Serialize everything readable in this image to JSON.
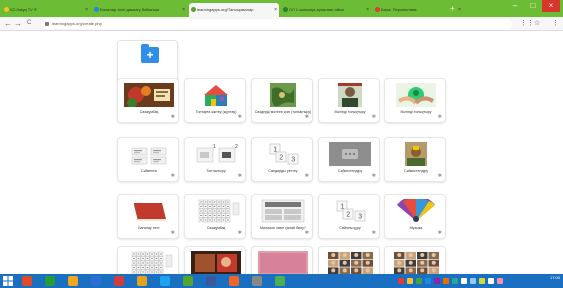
{
  "browser": {
    "tabs": [
      {
        "title": "KZ-Halyq TV ®",
        "color": "#f0c419",
        "active": false
      },
      {
        "title": "Балалар тілін дамыту бойынша",
        "color": "#1e88e5",
        "active": false
      },
      {
        "title": "learningapps.org/Тапсырмалар",
        "color": "#5aa02c",
        "active": true
      },
      {
        "title": "ОЛ 1 сыныпқа арналған ойын",
        "color": "#2e7d32",
        "active": false
      },
      {
        "title": "Бала. Перспектива",
        "color": "#e53935",
        "active": false
      }
    ],
    "tab_close_glyph": "×",
    "new_tab_glyph": "+",
    "window_controls": [
      "–",
      "□",
      "×"
    ],
    "url": "learningapps.org/create.php",
    "nav_glyphs": {
      "back": "←",
      "forward": "→",
      "reload": "C"
    },
    "right_glyphs": [
      "⋮⋮",
      "☆",
      "⋮"
    ]
  },
  "add_tile": {
    "icon": "add-folder-icon",
    "glyph": "+"
  },
  "gear_glyph": "✱",
  "tiles": [
    {
      "label": "Сөзжұмбақ",
      "thumb": "crossword-photo",
      "row": 0,
      "col": 0
    },
    {
      "label": "Топтарға жіктеу (жұптау)",
      "thumb": "colorful-house",
      "row": 0,
      "col": 1
    },
    {
      "label": "Сөздерді мәтінге қою (толықтыру)",
      "thumb": "green-map",
      "row": 0,
      "col": 2
    },
    {
      "label": "Мәтінді толықтыру",
      "thumb": "portrait",
      "row": 0,
      "col": 3
    },
    {
      "label": "Мәтінді толықтыру",
      "thumb": "green-hands",
      "row": 0,
      "col": 4
    },
    {
      "label": "Сәйкестік",
      "thumb": "matching-cards",
      "row": 1,
      "col": 0
    },
    {
      "label": "Топтастыру",
      "thumb": "grouping-cards",
      "row": 1,
      "col": 1
    },
    {
      "label": "Сандарды реттеу",
      "thumb": "numbers-123",
      "row": 1,
      "col": 2
    },
    {
      "label": "Сәйкестендіру",
      "thumb": "grey-chat",
      "row": 1,
      "col": 3
    },
    {
      "label": "Сәйкестендіру",
      "thumb": "photo-quiz",
      "row": 1,
      "col": 4
    },
    {
      "label": "Бағалау тест",
      "thumb": "red-book",
      "row": 2,
      "col": 0
    },
    {
      "label": "Сөзжұмбақ",
      "thumb": "letter-grid",
      "row": 2,
      "col": 1
    },
    {
      "label": "Миллион кімге қалай бөлу?",
      "thumb": "quiz-form",
      "row": 2,
      "col": 2
    },
    {
      "label": "Сөйлем құру",
      "thumb": "numbers-123",
      "row": 2,
      "col": 3
    },
    {
      "label": "Музыка",
      "thumb": "music-fan",
      "row": 2,
      "col": 4
    },
    {
      "label": "",
      "thumb": "letter-grid",
      "row": 3,
      "col": 0
    },
    {
      "label": "",
      "thumb": "video",
      "row": 3,
      "col": 1
    },
    {
      "label": "",
      "thumb": "pink-paper",
      "row": 3,
      "col": 2
    },
    {
      "label": "",
      "thumb": "face-grid",
      "row": 3,
      "col": 3
    },
    {
      "label": "",
      "thumb": "face-grid",
      "row": 3,
      "col": 4
    }
  ],
  "taskbar": {
    "apps": [
      "#e04a2a",
      "#2b9a3b",
      "#f2a81d",
      "#2a6fd1",
      "#d43b3b",
      "#e6a21a",
      "#1da1f2",
      "#55a630",
      "#3b5998",
      "#f06529",
      "#888888",
      "#4caf50"
    ],
    "tray": [
      "#e53935",
      "#fbc02d",
      "#43a047",
      "#1e88e5",
      "#8e24aa",
      "#ef6c00",
      "#26a69a",
      "#ffffff",
      "#90caf9",
      "#cddc39",
      "#ffffff",
      "#f48fb1"
    ],
    "clock": "17:00"
  },
  "colors": {
    "chrome_green": "#6cbc35",
    "taskbar_blue": "#1a6fc0",
    "accent_blue": "#2f8ee8"
  }
}
